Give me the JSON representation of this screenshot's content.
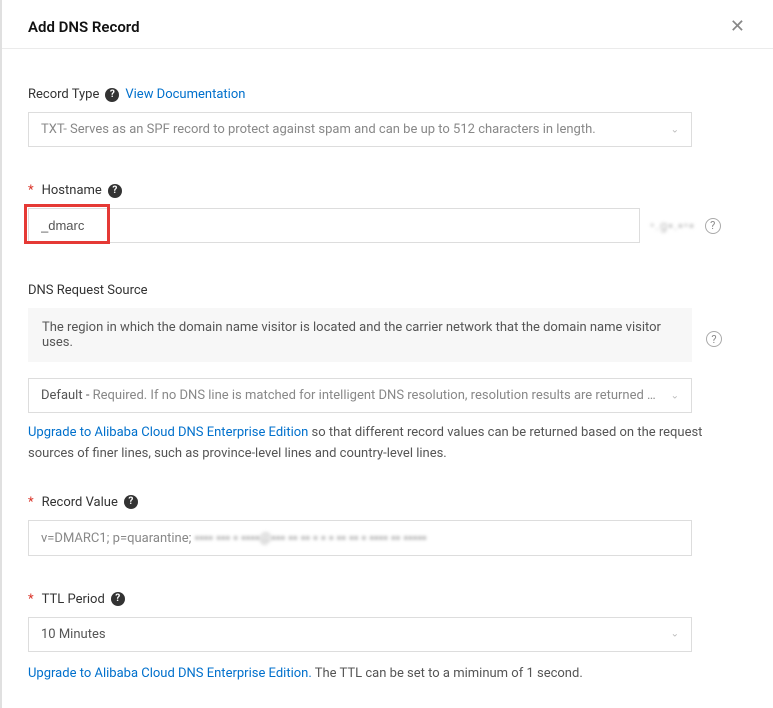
{
  "header": {
    "title": "Add DNS Record"
  },
  "recordType": {
    "label": "Record Type",
    "docLink": "View Documentation",
    "selected": "TXT- Serves as an SPF record to protect against spam and can be up to 512 characters in length."
  },
  "hostname": {
    "label": "Hostname",
    "value": "_dmarc",
    "suffix": "•.g▪.▪•▪"
  },
  "dnsRequestSource": {
    "label": "DNS Request Source",
    "info": "The region in which the domain name visitor is located and the carrier network that the domain name visitor uses.",
    "selectedPrefix": "Default - ",
    "selected": "Required. If no DNS line is matched for intelligent DNS resolution, resolution results are returned based on t...",
    "upgradeLink": "Upgrade to Alibaba Cloud DNS Enterprise Edition",
    "upgradeText": " so that different record values can be returned based on the request sources of finer lines, such as province-level lines and country-level lines."
  },
  "recordValue": {
    "label": "Record Value",
    "valueVisible": "v=DMARC1; p=quarantine; ",
    "valueBlurred": "▪▪▪▪ ▪▪▪  ▪    ▪▪▪▪@▪▪▪ ▪▪ ▪▪ ▪  ▪   ▪  ▪▪ ▪▪ ▪   ▪▪▪▪ ▪▪ ▪▪▪▪▪"
  },
  "ttl": {
    "label": "TTL Period",
    "selected": "10 Minutes",
    "upgradeLink": "Upgrade to Alibaba Cloud DNS Enterprise Edition.",
    "upgradeText": " The TTL can be set to a miminum of 1 second."
  }
}
